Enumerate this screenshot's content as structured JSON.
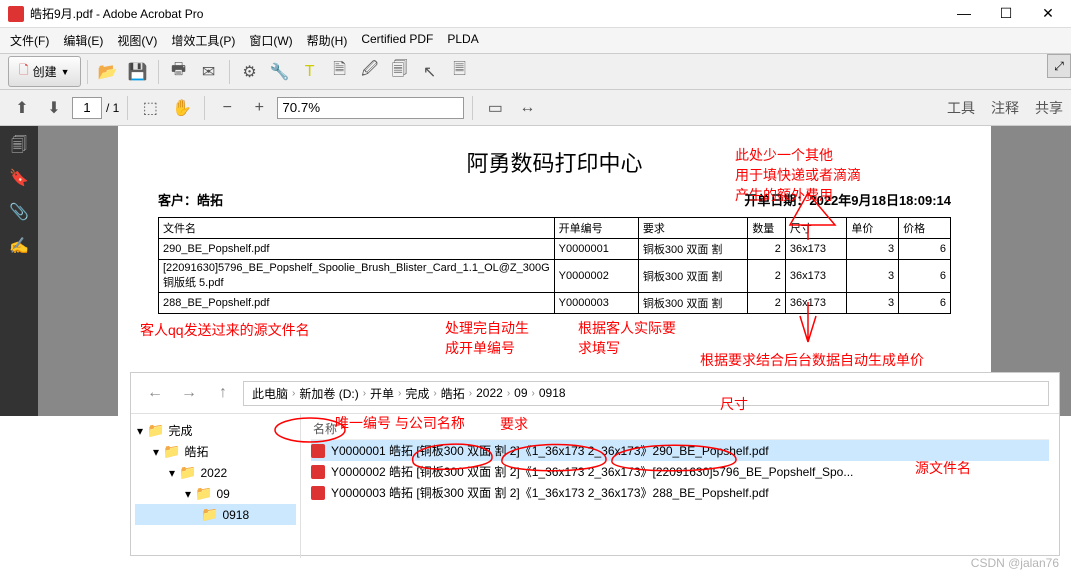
{
  "window": {
    "title": "皓拓9月.pdf - Adobe Acrobat Pro"
  },
  "menu": {
    "file": "文件(F)",
    "edit": "编辑(E)",
    "view": "视图(V)",
    "tools": "增效工具(P)",
    "window": "窗口(W)",
    "help": "帮助(H)",
    "certified": "Certified PDF",
    "plda": "PLDA"
  },
  "toolbar": {
    "create": "创建",
    "page_current": "1",
    "page_total": "/ 1",
    "zoom": "70.7%"
  },
  "tabs": {
    "tools": "工具",
    "comment": "注释",
    "share": "共享"
  },
  "pdf": {
    "title": "阿勇数码打印中心",
    "customer_label": "客户：",
    "customer": "皓拓",
    "date_label": "开单日期：",
    "date": "2022年9月18日18:09:14",
    "cols": {
      "c1": "文件名",
      "c2": "开单编号",
      "c3": "要求",
      "c4": "数量",
      "c5": "尺寸",
      "c6": "单价",
      "c7": "价格"
    },
    "rows": [
      {
        "file": "290_BE_Popshelf.pdf",
        "no": "Y0000001",
        "req": "铜板300 双面 割",
        "qty": "2",
        "size": "36x173",
        "price": "3",
        "total": "6"
      },
      {
        "file": "[22091630]5796_BE_Popshelf_Spoolie_Brush_Blister_Card_1.1_OL@Z_300G铜版纸 5.pdf",
        "no": "Y0000002",
        "req": "铜板300 双面 割",
        "qty": "2",
        "size": "36x173",
        "price": "3",
        "total": "6"
      },
      {
        "file": "288_BE_Popshelf.pdf",
        "no": "Y0000003",
        "req": "铜板300 双面 割",
        "qty": "2",
        "size": "36x173",
        "price": "3",
        "total": "6"
      }
    ]
  },
  "annotations": {
    "a1": "此处少一个其他",
    "a2": "用于填快递或者滴滴",
    "a3": "产生的额外费用",
    "b1": "客人qq发送过来的源文件名",
    "b2": "处理完自动生成开单编号",
    "b3": "根据客人实际要求填写",
    "b4": "根据要求结合后台数据自动生成单价",
    "c1": "唯一编号 与公司名称",
    "c2": "要求",
    "c3": "尺寸",
    "c4": "源文件名"
  },
  "explorer": {
    "crumbs": [
      "此电脑",
      "新加卷 (D:)",
      "开单",
      "完成",
      "皓拓",
      "2022",
      "09",
      "0918"
    ],
    "tree": {
      "root": "完成",
      "l1": "皓拓",
      "l2": "2022",
      "l3": "09",
      "l4": "0918"
    },
    "header": "名称",
    "files": [
      "Y0000001 皓拓 [铜板300 双面 割 2]《1_36x173 2_36x173》290_BE_Popshelf.pdf",
      "Y0000002 皓拓 [铜板300 双面 割 2]《1_36x173 2_36x173》[22091630]5796_BE_Popshelf_Spo...",
      "Y0000003 皓拓 [铜板300 双面 割 2]《1_36x173 2_36x173》288_BE_Popshelf.pdf"
    ]
  },
  "watermark": "CSDN @jalan76"
}
